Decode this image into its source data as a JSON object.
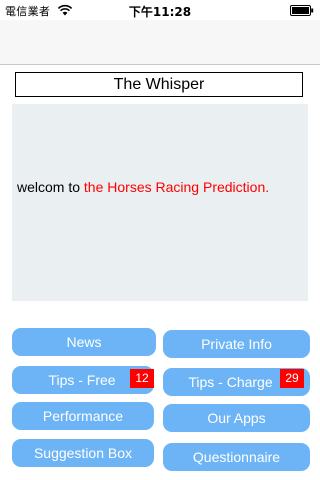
{
  "status_bar": {
    "carrier": "電信業者",
    "time": "下午11:28",
    "icons": [
      "wifi-icon",
      "battery-icon"
    ]
  },
  "title": "The Whisper",
  "message": {
    "prefix": "welcom to ",
    "highlight": "the Horses Racing Prediction.",
    "highlight_color": "#ff0000"
  },
  "menu": {
    "news": "News",
    "private_info": "Private Info",
    "tips_free": "Tips - Free",
    "tips_free_badge": "12",
    "tips_charge": "Tips - Charge",
    "tips_charge_badge": "29",
    "performance": "Performance",
    "our_apps": "Our Apps",
    "suggestion_box": "Suggestion Box",
    "questionnaire": "Questionnaire"
  },
  "colors": {
    "button": "#6cb4f5",
    "badge": "#ff0000",
    "panel": "#eaeff2"
  }
}
